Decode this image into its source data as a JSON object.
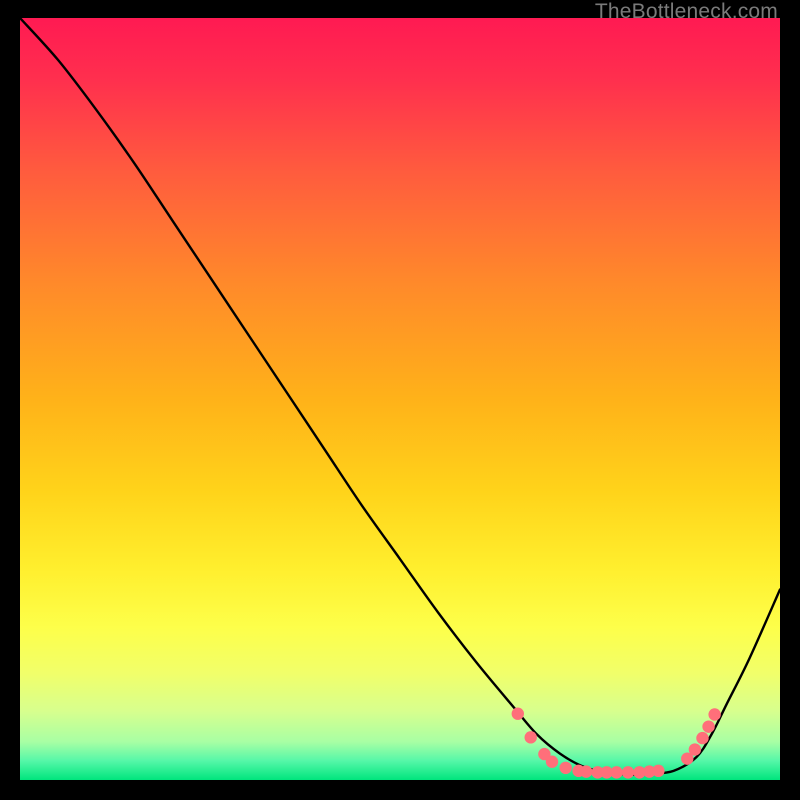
{
  "watermark": "TheBottleneck.com",
  "chart_data": {
    "type": "line",
    "title": "",
    "xlabel": "",
    "ylabel": "",
    "xlim": [
      0,
      1
    ],
    "ylim": [
      0,
      1
    ],
    "background_gradient": [
      {
        "stop": 0.0,
        "color": "#ff1a52"
      },
      {
        "stop": 0.08,
        "color": "#ff2f4e"
      },
      {
        "stop": 0.2,
        "color": "#ff5b3e"
      },
      {
        "stop": 0.35,
        "color": "#ff8a2a"
      },
      {
        "stop": 0.5,
        "color": "#ffb219"
      },
      {
        "stop": 0.62,
        "color": "#ffd31a"
      },
      {
        "stop": 0.72,
        "color": "#ffee2d"
      },
      {
        "stop": 0.8,
        "color": "#fdff4a"
      },
      {
        "stop": 0.86,
        "color": "#f1ff6a"
      },
      {
        "stop": 0.91,
        "color": "#d7ff8e"
      },
      {
        "stop": 0.95,
        "color": "#a8ffa4"
      },
      {
        "stop": 0.975,
        "color": "#55f7a8"
      },
      {
        "stop": 1.0,
        "color": "#00e57d"
      }
    ],
    "series": [
      {
        "name": "bottleneck-curve",
        "x": [
          0.0,
          0.05,
          0.1,
          0.15,
          0.2,
          0.25,
          0.3,
          0.35,
          0.4,
          0.45,
          0.5,
          0.55,
          0.6,
          0.65,
          0.68,
          0.71,
          0.74,
          0.77,
          0.8,
          0.83,
          0.86,
          0.89,
          0.91,
          0.93,
          0.96,
          1.0
        ],
        "y": [
          1.0,
          0.945,
          0.88,
          0.81,
          0.735,
          0.66,
          0.585,
          0.51,
          0.435,
          0.36,
          0.29,
          0.22,
          0.155,
          0.095,
          0.06,
          0.035,
          0.018,
          0.01,
          0.007,
          0.008,
          0.012,
          0.03,
          0.06,
          0.1,
          0.16,
          0.25
        ]
      }
    ],
    "markers": {
      "name": "highlighted-points",
      "color": "#ff6f7a",
      "points": [
        {
          "x": 0.655,
          "y": 0.087
        },
        {
          "x": 0.672,
          "y": 0.056
        },
        {
          "x": 0.69,
          "y": 0.034
        },
        {
          "x": 0.7,
          "y": 0.024
        },
        {
          "x": 0.718,
          "y": 0.016
        },
        {
          "x": 0.735,
          "y": 0.012
        },
        {
          "x": 0.745,
          "y": 0.011
        },
        {
          "x": 0.76,
          "y": 0.01
        },
        {
          "x": 0.772,
          "y": 0.01
        },
        {
          "x": 0.785,
          "y": 0.01
        },
        {
          "x": 0.8,
          "y": 0.01
        },
        {
          "x": 0.815,
          "y": 0.01
        },
        {
          "x": 0.828,
          "y": 0.011
        },
        {
          "x": 0.84,
          "y": 0.012
        },
        {
          "x": 0.878,
          "y": 0.028
        },
        {
          "x": 0.888,
          "y": 0.04
        },
        {
          "x": 0.898,
          "y": 0.055
        },
        {
          "x": 0.906,
          "y": 0.07
        },
        {
          "x": 0.914,
          "y": 0.086
        }
      ]
    }
  }
}
